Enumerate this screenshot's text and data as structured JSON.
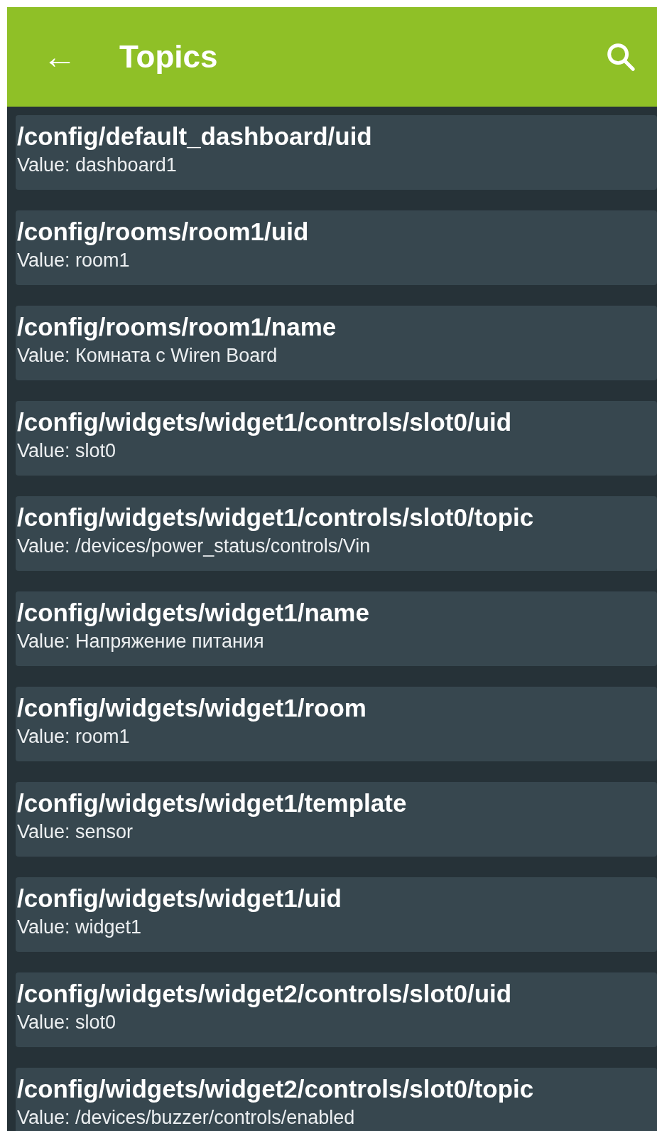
{
  "app_bar": {
    "back_glyph": "←",
    "title": "Topics"
  },
  "topics": [
    {
      "path": "/config/default_dashboard/uid",
      "value": "Value: dashboard1"
    },
    {
      "path": "/config/rooms/room1/uid",
      "value": "Value: room1"
    },
    {
      "path": "/config/rooms/room1/name",
      "value": "Value: Комната с Wiren Board"
    },
    {
      "path": "/config/widgets/widget1/controls/slot0/uid",
      "value": "Value: slot0"
    },
    {
      "path": "/config/widgets/widget1/controls/slot0/topic",
      "value": "Value: /devices/power_status/controls/Vin"
    },
    {
      "path": "/config/widgets/widget1/name",
      "value": "Value: Напряжение питания"
    },
    {
      "path": "/config/widgets/widget1/room",
      "value": "Value: room1"
    },
    {
      "path": "/config/widgets/widget1/template",
      "value": "Value: sensor"
    },
    {
      "path": "/config/widgets/widget1/uid",
      "value": "Value: widget1"
    },
    {
      "path": "/config/widgets/widget2/controls/slot0/uid",
      "value": "Value: slot0"
    },
    {
      "path": "/config/widgets/widget2/controls/slot0/topic",
      "value": "Value: /devices/buzzer/controls/enabled"
    }
  ]
}
